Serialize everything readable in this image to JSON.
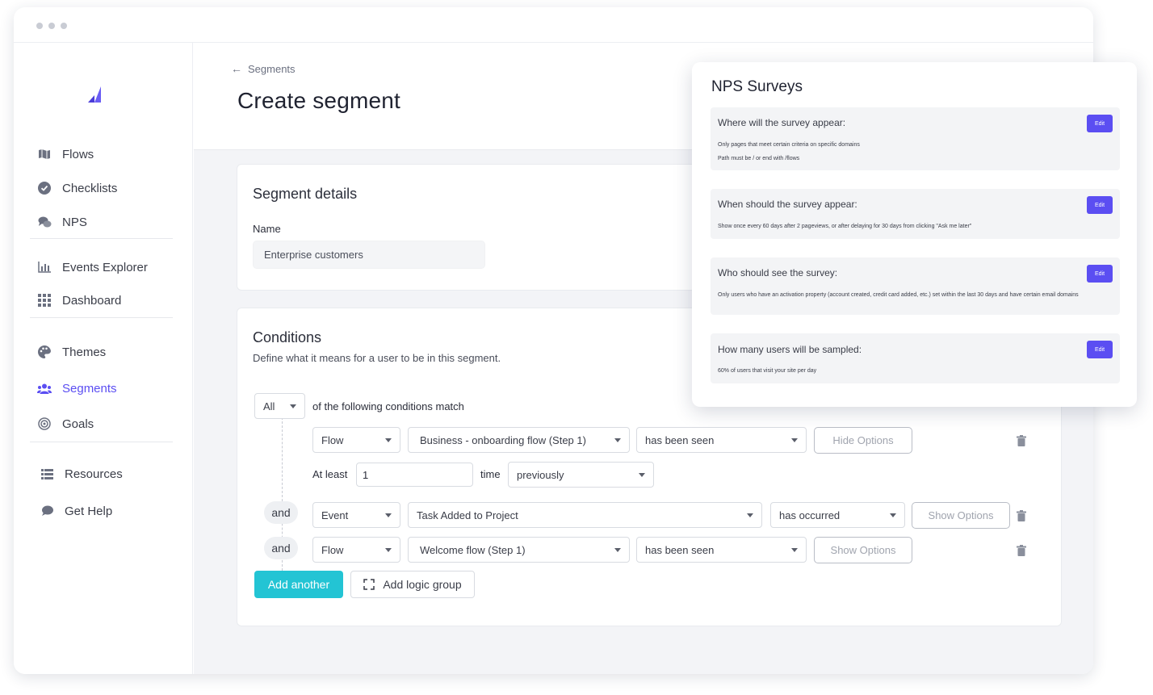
{
  "sidebar": {
    "items": [
      {
        "label": "Flows",
        "icon": "map-icon"
      },
      {
        "label": "Checklists",
        "icon": "check-circle-icon"
      },
      {
        "label": "NPS",
        "icon": "chat-bubbles-icon"
      },
      {
        "label": "Events Explorer",
        "icon": "bar-chart-icon"
      },
      {
        "label": "Dashboard",
        "icon": "grid-icon"
      },
      {
        "label": "Themes",
        "icon": "palette-icon"
      },
      {
        "label": "Segments",
        "icon": "users-icon"
      },
      {
        "label": "Goals",
        "icon": "target-icon"
      },
      {
        "label": "Resources",
        "icon": "list-icon"
      },
      {
        "label": "Get Help",
        "icon": "chat-icon"
      }
    ],
    "active": "Segments",
    "accent": "#5b4ef2"
  },
  "header": {
    "breadcrumb": "Segments",
    "title": "Create segment"
  },
  "details": {
    "title": "Segment details",
    "name_label": "Name",
    "name_value": "Enterprise customers"
  },
  "conditions": {
    "title": "Conditions",
    "subtitle": "Define what it means for a user to be in this segment.",
    "match_select": "All",
    "match_text": "of the following conditions match",
    "rows": [
      {
        "type": "Flow",
        "target": "Business - onboarding flow (Step 1)",
        "state": "has been seen",
        "options_button": "Hide Options"
      },
      {
        "connector": "and",
        "type": "Event",
        "target": "Task Added to Project",
        "state": "has occurred",
        "options_button": "Show Options"
      },
      {
        "connector": "and",
        "type": "Flow",
        "target": "Welcome flow (Step 1)",
        "state": "has been seen",
        "options_button": "Show Options"
      }
    ],
    "options": {
      "at_least_label": "At least",
      "count": "1",
      "time_label": "time",
      "when": "previously"
    },
    "add_another": "Add another",
    "add_logic_group": "Add logic group",
    "primary_color": "#23c4d4"
  },
  "nps": {
    "title": "NPS Surveys",
    "edit_label": "Edit",
    "rows": [
      {
        "question": "Where will the survey appear:",
        "lines": [
          "Only pages that meet certain criteria on specific domains",
          "Path must be / or end with /flows"
        ]
      },
      {
        "question": "When should the survey appear:",
        "lines": [
          "Show once every 60 days after 2 pageviews, or after delaying for 30 days from clicking \"Ask me later\""
        ]
      },
      {
        "question": "Who should see the survey:",
        "lines": [
          "Only users who have an activation property (account created, credit card added, etc.) set within the last 30 days and have certain email domains"
        ]
      },
      {
        "question": "How many users will be sampled:",
        "lines": [
          "60% of users that visit your site per day"
        ]
      }
    ]
  }
}
